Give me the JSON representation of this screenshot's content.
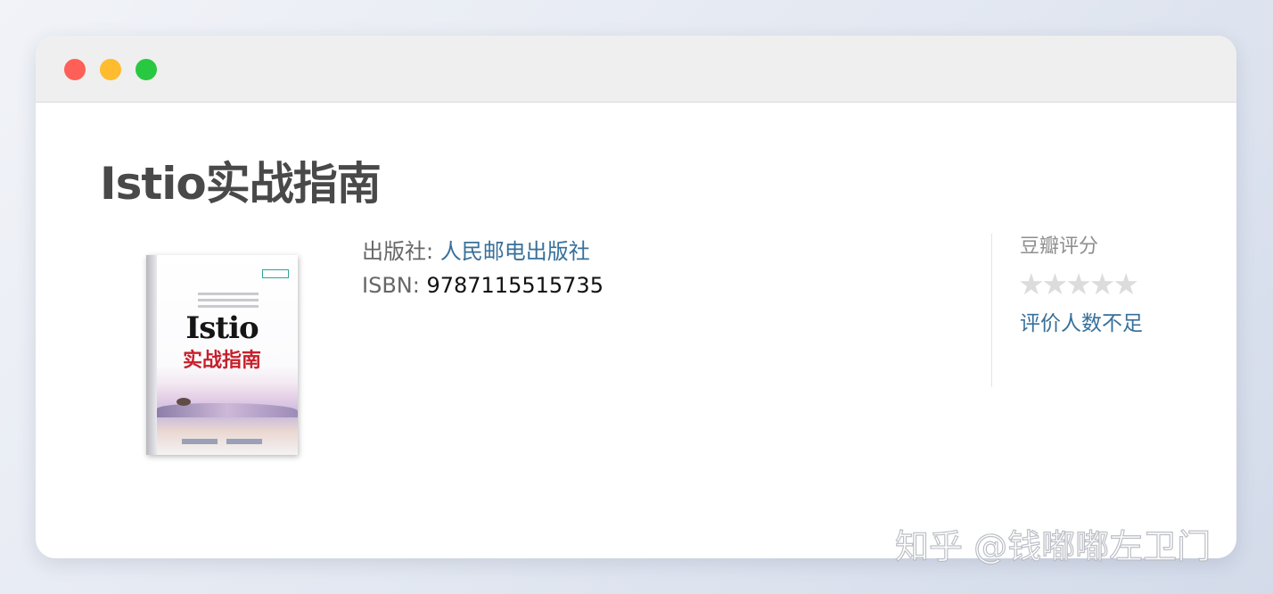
{
  "book": {
    "title": "Istio实战指南",
    "publisher_label": "出版社: ",
    "publisher": "人民邮电出版社",
    "isbn_label": "ISBN: ",
    "isbn": "9787115515735",
    "cover": {
      "title_en": "Istio",
      "title_cn": "实战指南"
    }
  },
  "rating": {
    "header": "豆瓣评分",
    "stars_filled": 0,
    "stars_total": 5,
    "status": "评价人数不足"
  },
  "watermark": "知乎 @钱嘟嘟左卫门",
  "colors": {
    "link": "#37709a",
    "title": "#494949",
    "star_empty": "#dcdcdc"
  }
}
